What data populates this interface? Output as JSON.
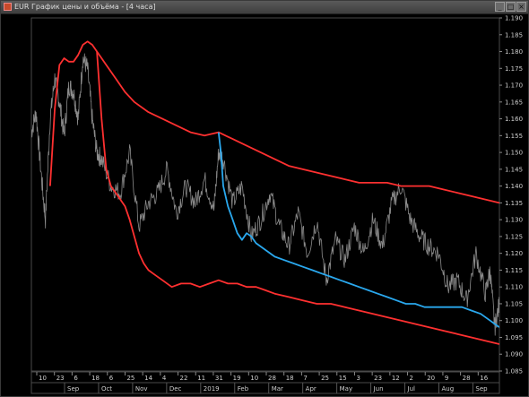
{
  "window": {
    "title": "EUR График цены и объёма - [4 часа]",
    "icon": "chart-window-icon",
    "controls": {
      "minimize": "_",
      "maximize": "□",
      "close": "×"
    }
  },
  "chart_data": {
    "type": "line",
    "title": "",
    "xlabel": "",
    "ylabel": "",
    "ylim": [
      1.085,
      1.19
    ],
    "grid": false,
    "y_ticks": [
      "1.190",
      "1.185",
      "1.180",
      "1.175",
      "1.170",
      "1.165",
      "1.160",
      "1.155",
      "1.150",
      "1.145",
      "1.140",
      "1.135",
      "1.130",
      "1.125",
      "1.120",
      "1.115",
      "1.110",
      "1.105",
      "1.100",
      "1.095",
      "1.090",
      "1.085"
    ],
    "x_day_ticks": [
      "10",
      "23",
      "6",
      "18",
      "6",
      "25",
      "14",
      "4",
      "22",
      "11",
      "31",
      "19",
      "10",
      "28",
      "18",
      "7",
      "25",
      "15",
      "3",
      "23",
      "12",
      "2",
      "20",
      "9",
      "28",
      "16"
    ],
    "x_month_ticks": [
      "Sep",
      "Oct",
      "Nov",
      "Dec",
      "2019",
      "Feb",
      "Mar",
      "Apr",
      "May",
      "Jun",
      "Jul",
      "Aug",
      "Sep"
    ],
    "series": [
      {
        "name": "",
        "color": "#8c8c8c",
        "style": "price",
        "x": [
          0,
          0.01,
          0.02,
          0.03,
          0.04,
          0.05,
          0.06,
          0.07,
          0.08,
          0.09,
          0.1,
          0.11,
          0.12,
          0.13,
          0.14,
          0.15,
          0.17,
          0.19,
          0.21,
          0.23,
          0.25,
          0.27,
          0.29,
          0.31,
          0.33,
          0.35,
          0.37,
          0.39,
          0.4,
          0.41,
          0.43,
          0.45,
          0.47,
          0.49,
          0.51,
          0.53,
          0.55,
          0.57,
          0.59,
          0.61,
          0.63,
          0.65,
          0.67,
          0.69,
          0.71,
          0.73,
          0.75,
          0.77,
          0.79,
          0.81,
          0.83,
          0.85,
          0.87,
          0.89,
          0.91,
          0.93,
          0.95,
          0.97,
          0.98,
          0.99,
          1.0
        ],
        "values": [
          1.156,
          1.162,
          1.145,
          1.13,
          1.16,
          1.172,
          1.165,
          1.155,
          1.17,
          1.168,
          1.16,
          1.178,
          1.175,
          1.16,
          1.15,
          1.148,
          1.14,
          1.138,
          1.15,
          1.128,
          1.135,
          1.138,
          1.145,
          1.132,
          1.14,
          1.135,
          1.142,
          1.133,
          1.15,
          1.148,
          1.135,
          1.14,
          1.125,
          1.13,
          1.138,
          1.128,
          1.122,
          1.132,
          1.12,
          1.13,
          1.112,
          1.124,
          1.118,
          1.128,
          1.12,
          1.13,
          1.122,
          1.135,
          1.14,
          1.13,
          1.125,
          1.122,
          1.12,
          1.11,
          1.112,
          1.106,
          1.12,
          1.108,
          1.115,
          1.098,
          1.105
        ]
      },
      {
        "name": "",
        "color": "#ff3030",
        "style": "upper-band",
        "x": [
          0.04,
          0.05,
          0.06,
          0.07,
          0.08,
          0.09,
          0.1,
          0.11,
          0.12,
          0.13,
          0.14,
          0.16,
          0.18,
          0.2,
          0.22,
          0.25,
          0.28,
          0.31,
          0.34,
          0.37,
          0.4,
          0.43,
          0.46,
          0.49,
          0.52,
          0.55,
          0.58,
          0.61,
          0.64,
          0.67,
          0.7,
          0.73,
          0.76,
          0.79,
          0.82,
          0.85,
          0.88,
          0.91,
          0.94,
          0.97,
          1.0
        ],
        "values": [
          1.14,
          1.163,
          1.176,
          1.178,
          1.177,
          1.177,
          1.179,
          1.182,
          1.183,
          1.182,
          1.18,
          1.176,
          1.172,
          1.168,
          1.165,
          1.162,
          1.16,
          1.158,
          1.156,
          1.155,
          1.156,
          1.154,
          1.152,
          1.15,
          1.148,
          1.146,
          1.145,
          1.144,
          1.143,
          1.142,
          1.141,
          1.141,
          1.141,
          1.14,
          1.14,
          1.14,
          1.139,
          1.138,
          1.137,
          1.136,
          1.135
        ]
      },
      {
        "name": "",
        "color": "#ff3030",
        "style": "lower-band",
        "x": [
          0.14,
          0.15,
          0.16,
          0.17,
          0.18,
          0.19,
          0.2,
          0.21,
          0.22,
          0.23,
          0.24,
          0.25,
          0.26,
          0.28,
          0.3,
          0.32,
          0.34,
          0.36,
          0.38,
          0.4,
          0.42,
          0.44,
          0.46,
          0.48,
          0.5,
          0.52,
          0.55,
          0.58,
          0.61,
          0.64,
          0.67,
          0.7,
          0.73,
          0.76,
          0.79,
          0.82,
          0.85,
          0.88,
          0.91,
          0.94,
          0.97,
          1.0
        ],
        "values": [
          1.18,
          1.16,
          1.145,
          1.14,
          1.138,
          1.136,
          1.134,
          1.13,
          1.125,
          1.12,
          1.117,
          1.115,
          1.114,
          1.112,
          1.11,
          1.111,
          1.111,
          1.11,
          1.111,
          1.112,
          1.111,
          1.111,
          1.11,
          1.11,
          1.109,
          1.108,
          1.107,
          1.106,
          1.105,
          1.105,
          1.104,
          1.103,
          1.102,
          1.101,
          1.1,
          1.099,
          1.098,
          1.097,
          1.096,
          1.095,
          1.094,
          1.093
        ]
      },
      {
        "name": "",
        "color": "#2aa8ee",
        "style": "vwap",
        "x": [
          0.4,
          0.405,
          0.41,
          0.42,
          0.43,
          0.44,
          0.45,
          0.46,
          0.47,
          0.48,
          0.5,
          0.52,
          0.54,
          0.56,
          0.58,
          0.6,
          0.62,
          0.64,
          0.66,
          0.68,
          0.7,
          0.72,
          0.74,
          0.76,
          0.78,
          0.8,
          0.82,
          0.84,
          0.86,
          0.88,
          0.9,
          0.92,
          0.94,
          0.96,
          0.98,
          0.99,
          1.0
        ],
        "values": [
          1.156,
          1.15,
          1.14,
          1.134,
          1.13,
          1.126,
          1.124,
          1.126,
          1.125,
          1.123,
          1.121,
          1.119,
          1.118,
          1.117,
          1.116,
          1.115,
          1.114,
          1.113,
          1.112,
          1.111,
          1.11,
          1.109,
          1.108,
          1.107,
          1.106,
          1.105,
          1.105,
          1.104,
          1.104,
          1.104,
          1.104,
          1.104,
          1.103,
          1.102,
          1.1,
          1.099,
          1.098
        ]
      }
    ]
  }
}
